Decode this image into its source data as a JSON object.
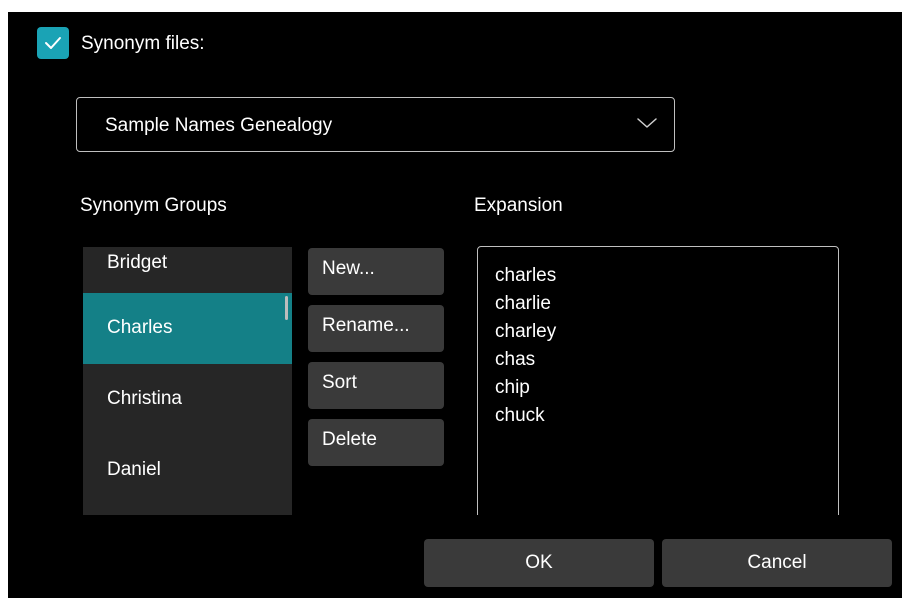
{
  "synonym_files": {
    "checked": true,
    "label": "Synonym files:"
  },
  "file_dropdown": {
    "selected": "Sample Names Genealogy"
  },
  "groups": {
    "label": "Synonym Groups",
    "items": [
      {
        "label": "Bridget",
        "selected": false
      },
      {
        "label": "Charles",
        "selected": true
      },
      {
        "label": "Christina",
        "selected": false
      },
      {
        "label": "Daniel",
        "selected": false
      }
    ]
  },
  "actions": {
    "new_label": "New...",
    "rename_label": "Rename...",
    "sort_label": "Sort",
    "delete_label": "Delete"
  },
  "expansion": {
    "label": "Expansion",
    "text": "charles\ncharlie\ncharley\nchas\nchip\nchuck"
  },
  "footer": {
    "ok_label": "OK",
    "cancel_label": "Cancel"
  },
  "colors": {
    "accent": "#1aa3b5",
    "selected_row": "#148087",
    "button": "#3a3a3a",
    "list_bg": "#262626",
    "background": "#000000"
  }
}
